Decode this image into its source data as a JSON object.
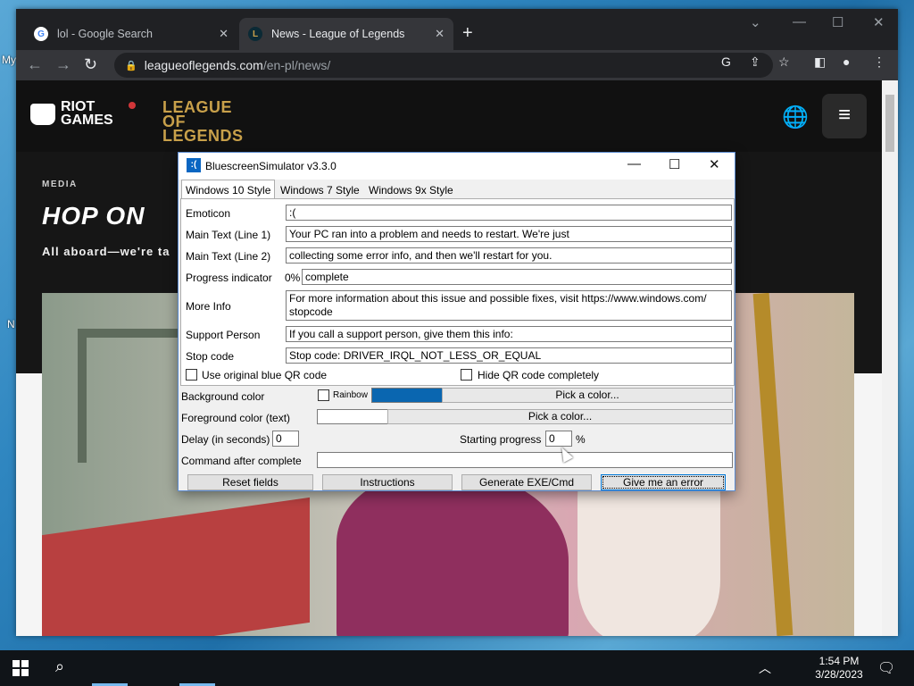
{
  "desktop": {
    "left_labels": [
      "My",
      "N"
    ]
  },
  "browser": {
    "tabs": [
      {
        "label": "lol - Google Search"
      },
      {
        "label": "News - League of Legends"
      }
    ],
    "url": {
      "domain": "leagueoflegends.com",
      "path": "/en-pl/news/"
    }
  },
  "site": {
    "riot_logo": "RIOT GAMES",
    "lol_logo": "LEAGUE OF LEGENDS",
    "hero": {
      "category": "MEDIA",
      "title": "HOP ON",
      "subtitle": "All aboard—we're ta"
    }
  },
  "app": {
    "title": "BluescreenSimulator v3.3.0",
    "icon_text": ":(",
    "tabs": [
      "Windows 10 Style",
      "Windows 7 Style",
      "Windows 9x Style"
    ],
    "fields": {
      "emoticon": {
        "label": "Emoticon",
        "value": ":("
      },
      "main1": {
        "label": "Main Text (Line 1)",
        "value": "Your PC ran into a problem and needs to restart. We're just"
      },
      "main2": {
        "label": "Main Text (Line 2)",
        "value": "collecting some error info, and then we'll restart for you."
      },
      "progress": {
        "label": "Progress indicator",
        "percent": "0%",
        "value": "complete"
      },
      "moreinfo": {
        "label": "More Info",
        "value": "For more information about this issue and possible fixes, visit https://www.windows.com/ stopcode"
      },
      "support": {
        "label": "Support Person",
        "value": "If you call a support person, give them this info:"
      },
      "stopcode": {
        "label": "Stop code",
        "value": "Stop code: DRIVER_IRQL_NOT_LESS_OR_EQUAL"
      }
    },
    "checkboxes": {
      "original_qr": "Use original blue QR code",
      "hide_qr": "Hide QR code completely"
    },
    "options": {
      "bg_label": "Background color",
      "rainbow_label": "Rainbow",
      "pick_color": "Pick a color...",
      "fg_label": "Foreground color (text)",
      "delay_label": "Delay (in seconds)",
      "delay_value": "0",
      "start_progress_label": "Starting progress",
      "start_progress_value": "0",
      "percent_sign": "%",
      "command_label": "Command after complete",
      "command_value": ""
    },
    "buttons": {
      "reset": "Reset fields",
      "instructions": "Instructions",
      "generate": "Generate EXE/Cmd",
      "error": "Give me an error"
    },
    "colors": {
      "background": "#0a66b0",
      "foreground": "#ffffff"
    }
  },
  "taskbar": {
    "time": "1:54 PM",
    "date": "3/28/2023"
  }
}
